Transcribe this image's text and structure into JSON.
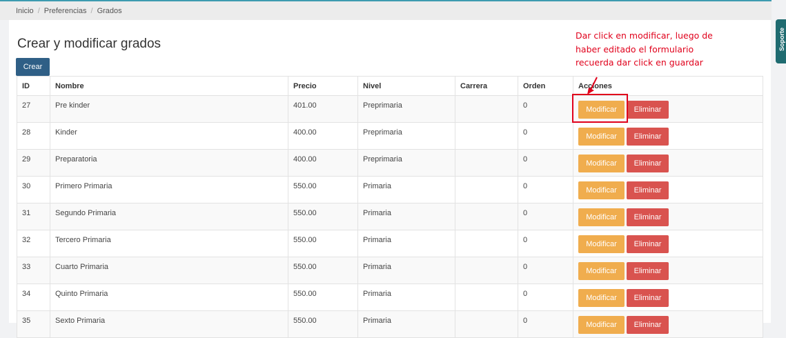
{
  "breadcrumb": [
    "Inicio",
    "Preferencias",
    "Grados"
  ],
  "page_title": "Crear y modificar grados",
  "create_label": "Crear",
  "table": {
    "headers": [
      "ID",
      "Nombre",
      "Precio",
      "Nivel",
      "Carrera",
      "Orden",
      "Acciones"
    ],
    "rows": [
      {
        "id": "27",
        "nombre": "Pre kinder",
        "precio": "401.00",
        "nivel": "Preprimaria",
        "carrera": "",
        "orden": "0"
      },
      {
        "id": "28",
        "nombre": "Kinder",
        "precio": "400.00",
        "nivel": "Preprimaria",
        "carrera": "",
        "orden": "0"
      },
      {
        "id": "29",
        "nombre": "Preparatoria",
        "precio": "400.00",
        "nivel": "Preprimaria",
        "carrera": "",
        "orden": "0"
      },
      {
        "id": "30",
        "nombre": "Primero Primaria",
        "precio": "550.00",
        "nivel": "Primaria",
        "carrera": "",
        "orden": "0"
      },
      {
        "id": "31",
        "nombre": "Segundo Primaria",
        "precio": "550.00",
        "nivel": "Primaria",
        "carrera": "",
        "orden": "0"
      },
      {
        "id": "32",
        "nombre": "Tercero Primaria",
        "precio": "550.00",
        "nivel": "Primaria",
        "carrera": "",
        "orden": "0"
      },
      {
        "id": "33",
        "nombre": "Cuarto Primaria",
        "precio": "550.00",
        "nivel": "Primaria",
        "carrera": "",
        "orden": "0"
      },
      {
        "id": "34",
        "nombre": "Quinto Primaria",
        "precio": "550.00",
        "nivel": "Primaria",
        "carrera": "",
        "orden": "0"
      },
      {
        "id": "35",
        "nombre": "Sexto Primaria",
        "precio": "550.00",
        "nivel": "Primaria",
        "carrera": "",
        "orden": "0"
      }
    ],
    "modify_label": "Modificar",
    "delete_label": "Eliminar"
  },
  "annotation_lines": [
    "Dar click en modificar, luego de",
    "haber editado el formulario",
    "recuerda dar click en guardar"
  ],
  "support_label": "Soporte",
  "colors": {
    "accent": "#3d9bb0",
    "create_button": "#2f5f86",
    "modify_button": "#f0ad4e",
    "delete_button": "#d9534f",
    "annotation": "#e0001b",
    "support_tab": "#1f6b70"
  }
}
